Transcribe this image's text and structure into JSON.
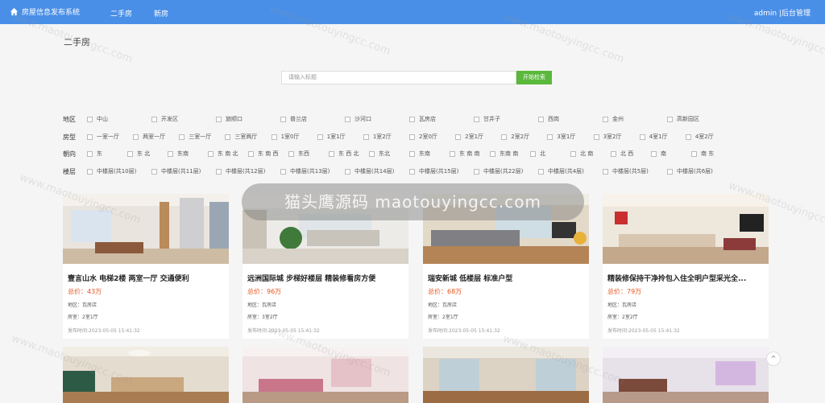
{
  "header": {
    "site_title": "房屋信息发布系统",
    "nav": [
      "二手房",
      "新房"
    ],
    "admin_label": "admin",
    "backend_label": "|后台管理"
  },
  "section_title": "二手房",
  "search": {
    "placeholder": "请输入标题",
    "button_label": "开始检索"
  },
  "filters": [
    {
      "label": "地区",
      "options": [
        "中山",
        "开发区",
        "旅顺口",
        "普兰店",
        "沙河口",
        "瓦房店",
        "甘井子",
        "西岗",
        "金州",
        "高新园区"
      ]
    },
    {
      "label": "房型",
      "options": [
        "一室一厅",
        "两室一厅",
        "三室一厅",
        "三室两厅",
        "1室0厅",
        "1室1厅",
        "1室2厅",
        "2室0厅",
        "2室1厅",
        "2室2厅",
        "3室1厅",
        "3室2厅",
        "4室1厅",
        "4室2厅"
      ]
    },
    {
      "label": "朝向",
      "options": [
        "东",
        "东 北",
        "东南",
        "东 南 北",
        "东 南 西",
        "东西",
        "东 西 北",
        "东北",
        "东南",
        "东 南 南",
        "东南 南",
        "北",
        "北 南",
        "北 西",
        "南",
        "南 东"
      ]
    },
    {
      "label": "楼层",
      "options": [
        "中楼层(共10层)",
        "中楼层(共11层)",
        "中楼层(共12层)",
        "中楼层(共13层)",
        "中楼层(共14层)",
        "中楼层(共15层)",
        "中楼层(共22层)",
        "中楼层(共4层)",
        "中楼层(共5层)",
        "中楼层(共6层)"
      ]
    }
  ],
  "listings": [
    {
      "title": "壹言山水 电梯2楼 两室一厅 交通便利",
      "price": "总价：43万",
      "district": "地区：瓦房店",
      "layout": "房室：2室1厅",
      "time": "发布时间:2023-05-05 15:41:32"
    },
    {
      "title": "远洲国际城 步梯好楼层 精装修看房方便",
      "price": "总价：96万",
      "district": "地区：瓦房店",
      "layout": "房室：3室2厅",
      "time": "发布时间:2023-05-05 15:41:32"
    },
    {
      "title": "瑞安新城 低楼层 标准户型",
      "price": "总价：68万",
      "district": "地区：瓦房店",
      "layout": "房室：2室1厅",
      "time": "发布时间:2023-05-05 15:41:32"
    },
    {
      "title": "精装修保持干净拎包入住全明户型采光全...",
      "price": "总价：79万",
      "district": "地区：瓦房店",
      "layout": "房室：2室2厅",
      "time": "发布时间:2023-05-05 15:41:32"
    }
  ],
  "watermark_text": "猫头鹰源码 maotouyingcc.com",
  "watermark_url": "www.maotouyingcc.com",
  "back_to_top": "^"
}
